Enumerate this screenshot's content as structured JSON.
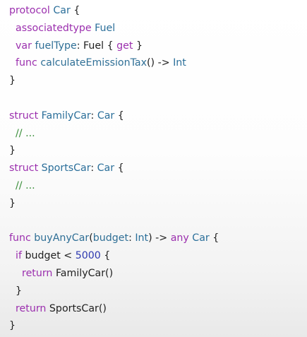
{
  "colors": {
    "keyword": "#9b2fae",
    "type": "#2b6f9a",
    "function": "#2f6f96",
    "comment": "#3a8e3a",
    "number": "#2d39b0",
    "plain": "#1f1f1f"
  },
  "code": {
    "lines": [
      [
        {
          "t": "protocol",
          "k": "keyword"
        },
        {
          "t": " ",
          "k": "plain"
        },
        {
          "t": "Car",
          "k": "type"
        },
        {
          "t": " {",
          "k": "plain"
        }
      ],
      [
        {
          "t": "  ",
          "k": "plain"
        },
        {
          "t": "associatedtype",
          "k": "keyword"
        },
        {
          "t": " ",
          "k": "plain"
        },
        {
          "t": "Fuel",
          "k": "type"
        }
      ],
      [
        {
          "t": "  ",
          "k": "plain"
        },
        {
          "t": "var",
          "k": "keyword"
        },
        {
          "t": " ",
          "k": "plain"
        },
        {
          "t": "fuelType",
          "k": "function"
        },
        {
          "t": ": Fuel { ",
          "k": "plain"
        },
        {
          "t": "get",
          "k": "keyword"
        },
        {
          "t": " }",
          "k": "plain"
        }
      ],
      [
        {
          "t": "  ",
          "k": "plain"
        },
        {
          "t": "func",
          "k": "keyword"
        },
        {
          "t": " ",
          "k": "plain"
        },
        {
          "t": "calculateEmissionTax",
          "k": "function"
        },
        {
          "t": "() -> ",
          "k": "plain"
        },
        {
          "t": "Int",
          "k": "type"
        }
      ],
      [
        {
          "t": "}",
          "k": "plain"
        }
      ],
      [],
      [
        {
          "t": "struct",
          "k": "keyword"
        },
        {
          "t": " ",
          "k": "plain"
        },
        {
          "t": "FamilyCar",
          "k": "type"
        },
        {
          "t": ": ",
          "k": "plain"
        },
        {
          "t": "Car",
          "k": "type"
        },
        {
          "t": " {",
          "k": "plain"
        }
      ],
      [
        {
          "t": "  ",
          "k": "plain"
        },
        {
          "t": "// ...",
          "k": "comment"
        }
      ],
      [
        {
          "t": "}",
          "k": "plain"
        }
      ],
      [
        {
          "t": "struct",
          "k": "keyword"
        },
        {
          "t": " ",
          "k": "plain"
        },
        {
          "t": "SportsCar",
          "k": "type"
        },
        {
          "t": ": ",
          "k": "plain"
        },
        {
          "t": "Car",
          "k": "type"
        },
        {
          "t": " {",
          "k": "plain"
        }
      ],
      [
        {
          "t": "  ",
          "k": "plain"
        },
        {
          "t": "// ...",
          "k": "comment"
        }
      ],
      [
        {
          "t": "}",
          "k": "plain"
        }
      ],
      [],
      [
        {
          "t": "func",
          "k": "keyword"
        },
        {
          "t": " ",
          "k": "plain"
        },
        {
          "t": "buyAnyCar",
          "k": "function"
        },
        {
          "t": "(",
          "k": "plain"
        },
        {
          "t": "budget",
          "k": "function"
        },
        {
          "t": ": ",
          "k": "plain"
        },
        {
          "t": "Int",
          "k": "type"
        },
        {
          "t": ") -> ",
          "k": "plain"
        },
        {
          "t": "any",
          "k": "keyword"
        },
        {
          "t": " ",
          "k": "plain"
        },
        {
          "t": "Car",
          "k": "type"
        },
        {
          "t": " {",
          "k": "plain"
        }
      ],
      [
        {
          "t": "  ",
          "k": "plain"
        },
        {
          "t": "if",
          "k": "keyword"
        },
        {
          "t": " budget < ",
          "k": "plain"
        },
        {
          "t": "5000",
          "k": "number"
        },
        {
          "t": " {",
          "k": "plain"
        }
      ],
      [
        {
          "t": "    ",
          "k": "plain"
        },
        {
          "t": "return",
          "k": "keyword"
        },
        {
          "t": " FamilyCar()",
          "k": "plain"
        }
      ],
      [
        {
          "t": "  }",
          "k": "plain"
        }
      ],
      [
        {
          "t": "  ",
          "k": "plain"
        },
        {
          "t": "return",
          "k": "keyword"
        },
        {
          "t": " SportsCar()",
          "k": "plain"
        }
      ],
      [
        {
          "t": "}",
          "k": "plain"
        }
      ]
    ]
  }
}
